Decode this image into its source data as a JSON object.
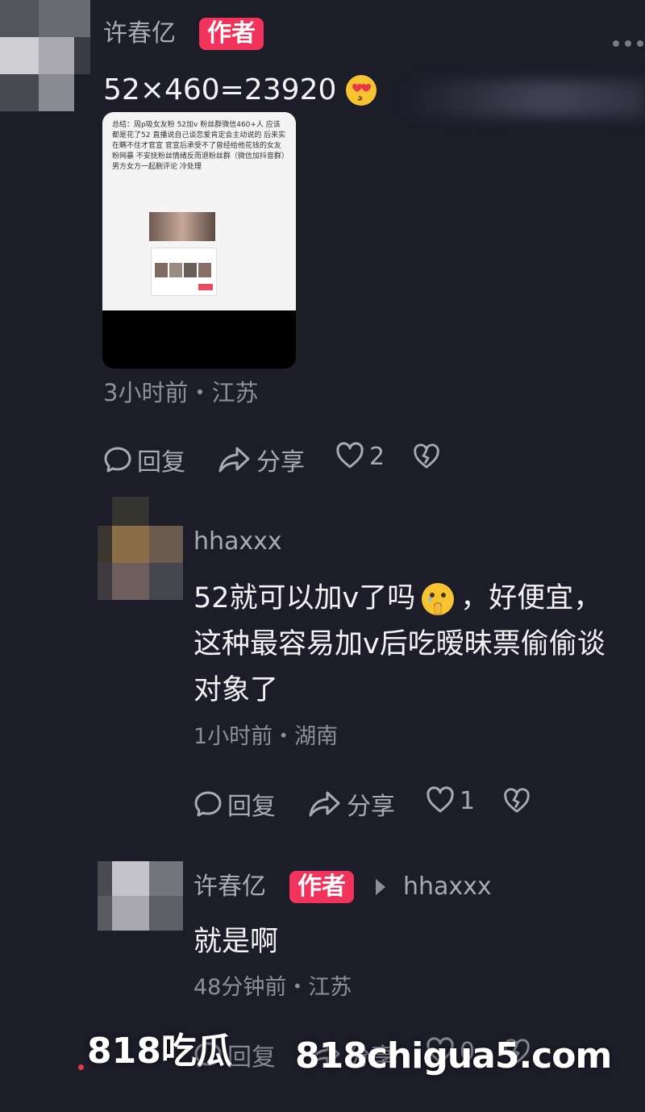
{
  "post": {
    "author": "许春亿",
    "author_badge": "作者",
    "text": "52×460=23920",
    "emoji": "heart-eyes-emoji",
    "image_caption": "总结：周p吸女友粉 52加v 粉丝群微信460+人 应该都是花了52 直播说自己谈恋爱肯定会主动说的 后来实在瞒不住才官宣 官宣后承受不了曾经给他花钱的女友粉网暴 不安抚粉丝情绪反而退粉丝群（微信加抖音群）男方女方一起删评论 冷处理",
    "time_location": "3小时前・江苏",
    "reply_label": "回复",
    "share_label": "分享",
    "like_count": "2"
  },
  "comments": [
    {
      "author": "hhaxxx",
      "text_line1": "52就可以加v了吗",
      "text_line1_rest": "，好便宜，",
      "text_line2": "这种最容易加v后吃暧昧票偷偷谈",
      "text_line3": "对象了",
      "emoji": "shushing-face-emoji",
      "time_location": "1小时前・湖南",
      "reply_label": "回复",
      "share_label": "分享",
      "like_count": "1"
    },
    {
      "author": "许春亿",
      "author_badge": "作者",
      "reply_to": "hhaxxx",
      "text": "就是啊",
      "time_location": "48分钟前・江苏",
      "reply_label": "回复",
      "share_label": "分享",
      "like_count": "0"
    }
  ],
  "watermark": {
    "left": "818吃瓜",
    "right": "818chigua5.com"
  },
  "colors": {
    "background": "#1c1d29",
    "badge": "#f2345c",
    "secondary_text": "#a9aab3"
  }
}
